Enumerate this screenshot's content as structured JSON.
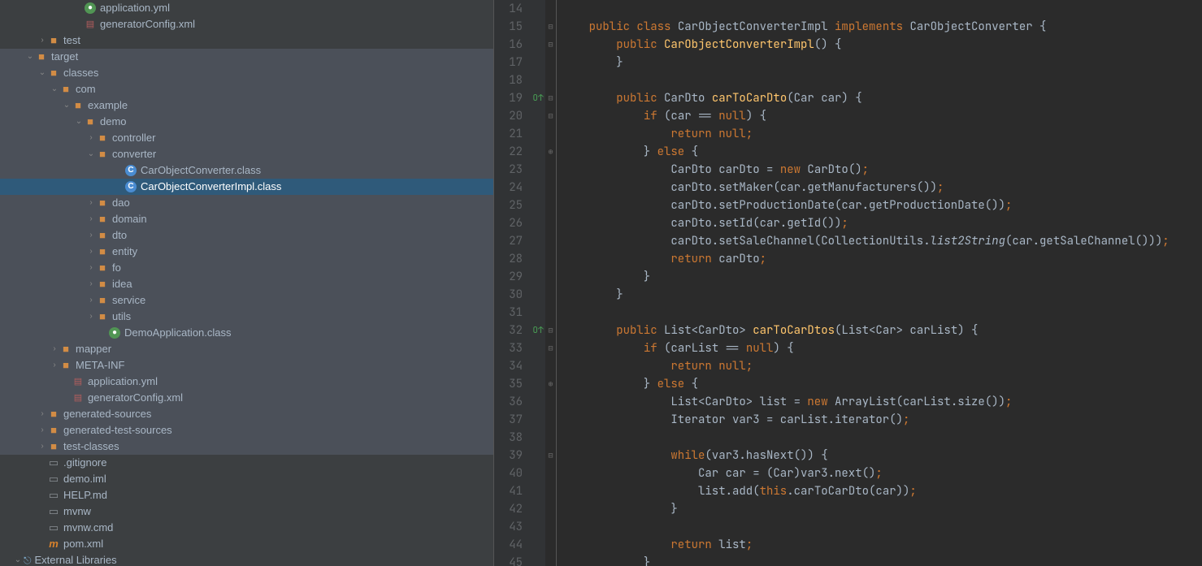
{
  "tree": [
    {
      "indent": 90,
      "chevron": "",
      "iconType": "green-dot",
      "label": "application.yml",
      "sel": false,
      "hl": false
    },
    {
      "indent": 90,
      "chevron": "",
      "iconType": "xml",
      "label": "generatorConfig.xml",
      "sel": false,
      "hl": false
    },
    {
      "indent": 45,
      "chevron": "›",
      "iconType": "folder",
      "label": "test",
      "sel": false,
      "hl": false
    },
    {
      "indent": 30,
      "chevron": "⌄",
      "iconType": "folder-open",
      "label": "target",
      "sel": false,
      "hl": true
    },
    {
      "indent": 45,
      "chevron": "⌄",
      "iconType": "folder-open",
      "label": "classes",
      "sel": false,
      "hl": true
    },
    {
      "indent": 60,
      "chevron": "⌄",
      "iconType": "folder-open",
      "label": "com",
      "sel": false,
      "hl": true
    },
    {
      "indent": 75,
      "chevron": "⌄",
      "iconType": "folder-open",
      "label": "example",
      "sel": false,
      "hl": true
    },
    {
      "indent": 90,
      "chevron": "⌄",
      "iconType": "folder-open",
      "label": "demo",
      "sel": false,
      "hl": true
    },
    {
      "indent": 105,
      "chevron": "›",
      "iconType": "folder",
      "label": "controller",
      "sel": false,
      "hl": true
    },
    {
      "indent": 105,
      "chevron": "⌄",
      "iconType": "folder-open",
      "label": "converter",
      "sel": false,
      "hl": true
    },
    {
      "indent": 140,
      "chevron": "",
      "iconType": "class",
      "label": "CarObjectConverter.class",
      "sel": false,
      "hl": true
    },
    {
      "indent": 140,
      "chevron": "",
      "iconType": "class",
      "label": "CarObjectConverterImpl.class",
      "sel": true,
      "hl": false
    },
    {
      "indent": 105,
      "chevron": "›",
      "iconType": "folder",
      "label": "dao",
      "sel": false,
      "hl": true
    },
    {
      "indent": 105,
      "chevron": "›",
      "iconType": "folder",
      "label": "domain",
      "sel": false,
      "hl": true
    },
    {
      "indent": 105,
      "chevron": "›",
      "iconType": "folder",
      "label": "dto",
      "sel": false,
      "hl": true
    },
    {
      "indent": 105,
      "chevron": "›",
      "iconType": "folder",
      "label": "entity",
      "sel": false,
      "hl": true
    },
    {
      "indent": 105,
      "chevron": "›",
      "iconType": "folder",
      "label": "fo",
      "sel": false,
      "hl": true
    },
    {
      "indent": 105,
      "chevron": "›",
      "iconType": "folder",
      "label": "idea",
      "sel": false,
      "hl": true
    },
    {
      "indent": 105,
      "chevron": "›",
      "iconType": "folder",
      "label": "service",
      "sel": false,
      "hl": true
    },
    {
      "indent": 105,
      "chevron": "›",
      "iconType": "folder",
      "label": "utils",
      "sel": false,
      "hl": true
    },
    {
      "indent": 120,
      "chevron": "",
      "iconType": "green-dot",
      "label": "DemoApplication.class",
      "sel": false,
      "hl": true
    },
    {
      "indent": 60,
      "chevron": "›",
      "iconType": "folder",
      "label": "mapper",
      "sel": false,
      "hl": true
    },
    {
      "indent": 60,
      "chevron": "›",
      "iconType": "folder",
      "label": "META-INF",
      "sel": false,
      "hl": true
    },
    {
      "indent": 75,
      "chevron": "",
      "iconType": "xml",
      "label": "application.yml",
      "sel": false,
      "hl": true
    },
    {
      "indent": 75,
      "chevron": "",
      "iconType": "xml",
      "label": "generatorConfig.xml",
      "sel": false,
      "hl": true
    },
    {
      "indent": 45,
      "chevron": "›",
      "iconType": "folder",
      "label": "generated-sources",
      "sel": false,
      "hl": true
    },
    {
      "indent": 45,
      "chevron": "›",
      "iconType": "folder",
      "label": "generated-test-sources",
      "sel": false,
      "hl": true
    },
    {
      "indent": 45,
      "chevron": "›",
      "iconType": "folder",
      "label": "test-classes",
      "sel": false,
      "hl": true
    },
    {
      "indent": 45,
      "chevron": "",
      "iconType": "file",
      "label": ".gitignore",
      "sel": false,
      "hl": false
    },
    {
      "indent": 45,
      "chevron": "",
      "iconType": "file",
      "label": "demo.iml",
      "sel": false,
      "hl": false
    },
    {
      "indent": 45,
      "chevron": "",
      "iconType": "file",
      "label": "HELP.md",
      "sel": false,
      "hl": false
    },
    {
      "indent": 45,
      "chevron": "",
      "iconType": "file",
      "label": "mvnw",
      "sel": false,
      "hl": false
    },
    {
      "indent": 45,
      "chevron": "",
      "iconType": "file",
      "label": "mvnw.cmd",
      "sel": false,
      "hl": false
    },
    {
      "indent": 45,
      "chevron": "",
      "iconType": "maven",
      "label": "pom.xml",
      "sel": false,
      "hl": false
    },
    {
      "indent": 15,
      "chevron": "⌄",
      "iconType": "ext-lib",
      "label": "External Libraries",
      "sel": false,
      "hl": false
    }
  ],
  "gutterStart": 14,
  "gutterEnd": 45,
  "markers": {
    "19": "O↑",
    "32": "O↑"
  },
  "code": [
    {
      "n": 14,
      "tokens": []
    },
    {
      "n": 15,
      "tokens": [
        {
          "c": "plain",
          "t": "    "
        },
        {
          "c": "k-public",
          "t": "public "
        },
        {
          "c": "k-class",
          "t": "class "
        },
        {
          "c": "plain",
          "t": "CarObjectConverterImpl "
        },
        {
          "c": "k-impl",
          "t": "implements "
        },
        {
          "c": "plain",
          "t": "CarObjectConverter {"
        }
      ]
    },
    {
      "n": 16,
      "tokens": [
        {
          "c": "plain",
          "t": "        "
        },
        {
          "c": "k-public",
          "t": "public "
        },
        {
          "c": "method",
          "t": "CarObjectConverterImpl"
        },
        {
          "c": "plain",
          "t": "() {"
        }
      ]
    },
    {
      "n": 17,
      "tokens": [
        {
          "c": "plain",
          "t": "        }"
        }
      ]
    },
    {
      "n": 18,
      "tokens": []
    },
    {
      "n": 19,
      "tokens": [
        {
          "c": "plain",
          "t": "        "
        },
        {
          "c": "k-public",
          "t": "public "
        },
        {
          "c": "plain",
          "t": "CarDto "
        },
        {
          "c": "method",
          "t": "carToCarDto"
        },
        {
          "c": "plain",
          "t": "(Car car) {"
        }
      ]
    },
    {
      "n": 20,
      "tokens": [
        {
          "c": "plain",
          "t": "            "
        },
        {
          "c": "k-if",
          "t": "if "
        },
        {
          "c": "plain",
          "t": "(car == "
        },
        {
          "c": "k-null",
          "t": "null"
        },
        {
          "c": "plain",
          "t": ") {"
        }
      ]
    },
    {
      "n": 21,
      "tokens": [
        {
          "c": "plain",
          "t": "                "
        },
        {
          "c": "k-return",
          "t": "return "
        },
        {
          "c": "k-null",
          "t": "null"
        },
        {
          "c": "semic",
          "t": ";"
        }
      ]
    },
    {
      "n": 22,
      "tokens": [
        {
          "c": "plain",
          "t": "            } "
        },
        {
          "c": "k-else",
          "t": "else "
        },
        {
          "c": "plain",
          "t": "{"
        }
      ]
    },
    {
      "n": 23,
      "tokens": [
        {
          "c": "plain",
          "t": "                CarDto carDto = "
        },
        {
          "c": "k-new",
          "t": "new "
        },
        {
          "c": "plain",
          "t": "CarDto()"
        },
        {
          "c": "semic",
          "t": ";"
        }
      ]
    },
    {
      "n": 24,
      "tokens": [
        {
          "c": "plain",
          "t": "                carDto.setMaker(car.getManufacturers())"
        },
        {
          "c": "semic",
          "t": ";"
        }
      ]
    },
    {
      "n": 25,
      "tokens": [
        {
          "c": "plain",
          "t": "                carDto.setProductionDate(car.getProductionDate())"
        },
        {
          "c": "semic",
          "t": ";"
        }
      ]
    },
    {
      "n": 26,
      "tokens": [
        {
          "c": "plain",
          "t": "                carDto.setId(car.getId())"
        },
        {
          "c": "semic",
          "t": ";"
        }
      ]
    },
    {
      "n": 27,
      "tokens": [
        {
          "c": "plain",
          "t": "                carDto.setSaleChannel(CollectionUtils."
        },
        {
          "c": "ital",
          "t": "list2String"
        },
        {
          "c": "plain",
          "t": "(car.getSaleChannel()))"
        },
        {
          "c": "semic",
          "t": ";"
        }
      ]
    },
    {
      "n": 28,
      "tokens": [
        {
          "c": "plain",
          "t": "                "
        },
        {
          "c": "k-return",
          "t": "return "
        },
        {
          "c": "plain",
          "t": "carDto"
        },
        {
          "c": "semic",
          "t": ";"
        }
      ]
    },
    {
      "n": 29,
      "tokens": [
        {
          "c": "plain",
          "t": "            }"
        }
      ]
    },
    {
      "n": 30,
      "tokens": [
        {
          "c": "plain",
          "t": "        }"
        }
      ]
    },
    {
      "n": 31,
      "tokens": []
    },
    {
      "n": 32,
      "tokens": [
        {
          "c": "plain",
          "t": "        "
        },
        {
          "c": "k-public",
          "t": "public "
        },
        {
          "c": "plain",
          "t": "List<CarDto> "
        },
        {
          "c": "method",
          "t": "carToCarDtos"
        },
        {
          "c": "plain",
          "t": "(List<Car> carList) {"
        }
      ]
    },
    {
      "n": 33,
      "tokens": [
        {
          "c": "plain",
          "t": "            "
        },
        {
          "c": "k-if",
          "t": "if "
        },
        {
          "c": "plain",
          "t": "(carList == "
        },
        {
          "c": "k-null",
          "t": "null"
        },
        {
          "c": "plain",
          "t": ") {"
        }
      ]
    },
    {
      "n": 34,
      "tokens": [
        {
          "c": "plain",
          "t": "                "
        },
        {
          "c": "k-return",
          "t": "return "
        },
        {
          "c": "k-null",
          "t": "null"
        },
        {
          "c": "semic",
          "t": ";"
        }
      ]
    },
    {
      "n": 35,
      "tokens": [
        {
          "c": "plain",
          "t": "            } "
        },
        {
          "c": "k-else",
          "t": "else "
        },
        {
          "c": "plain",
          "t": "{"
        }
      ]
    },
    {
      "n": 36,
      "tokens": [
        {
          "c": "plain",
          "t": "                List<CarDto> list = "
        },
        {
          "c": "k-new",
          "t": "new "
        },
        {
          "c": "plain",
          "t": "ArrayList(carList.size())"
        },
        {
          "c": "semic",
          "t": ";"
        }
      ]
    },
    {
      "n": 37,
      "tokens": [
        {
          "c": "plain",
          "t": "                Iterator var3 = carList.iterator()"
        },
        {
          "c": "semic",
          "t": ";"
        }
      ]
    },
    {
      "n": 38,
      "tokens": []
    },
    {
      "n": 39,
      "tokens": [
        {
          "c": "plain",
          "t": "                "
        },
        {
          "c": "k-while",
          "t": "while"
        },
        {
          "c": "plain",
          "t": "(var3.hasNext()) {"
        }
      ]
    },
    {
      "n": 40,
      "tokens": [
        {
          "c": "plain",
          "t": "                    Car car = (Car)var3.next()"
        },
        {
          "c": "semic",
          "t": ";"
        }
      ]
    },
    {
      "n": 41,
      "tokens": [
        {
          "c": "plain",
          "t": "                    list.add("
        },
        {
          "c": "k-this",
          "t": "this"
        },
        {
          "c": "plain",
          "t": ".carToCarDto(car))"
        },
        {
          "c": "semic",
          "t": ";"
        }
      ]
    },
    {
      "n": 42,
      "tokens": [
        {
          "c": "plain",
          "t": "                }"
        }
      ]
    },
    {
      "n": 43,
      "tokens": []
    },
    {
      "n": 44,
      "tokens": [
        {
          "c": "plain",
          "t": "                "
        },
        {
          "c": "k-return",
          "t": "return "
        },
        {
          "c": "plain",
          "t": "list"
        },
        {
          "c": "semic",
          "t": ";"
        }
      ]
    },
    {
      "n": 45,
      "tokens": [
        {
          "c": "plain",
          "t": "            }"
        }
      ]
    }
  ],
  "foldMarks": {
    "15": "⊟",
    "16": "⊟",
    "17": "⊥",
    "19": "⊟",
    "20": "⊟",
    "22": "⊕",
    "29": "⊥",
    "30": "⊥",
    "32": "⊟",
    "33": "⊟",
    "35": "⊕",
    "39": "⊟",
    "42": "⊥",
    "45": "⊥"
  }
}
